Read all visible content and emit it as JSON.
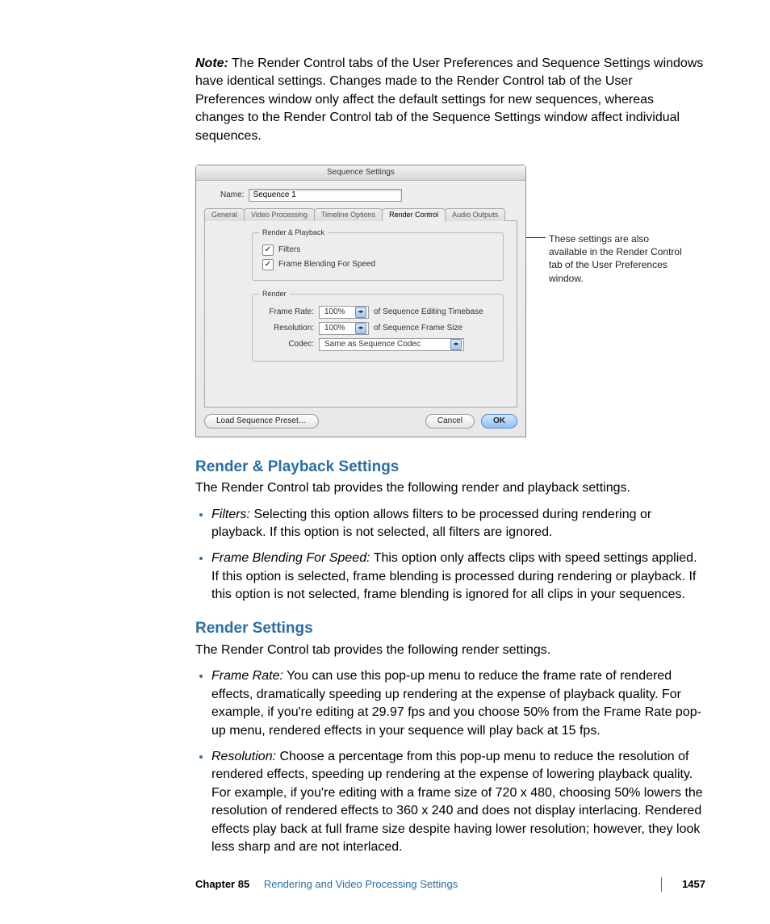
{
  "note": {
    "label": "Note:",
    "text": "The Render Control tabs of the User Preferences and Sequence Settings windows have identical settings. Changes made to the Render Control tab of the User Preferences window only affect the default settings for new sequences, whereas changes to the Render Control tab of the Sequence Settings window affect individual sequences."
  },
  "window": {
    "title": "Sequence Settings",
    "name_label": "Name:",
    "name_value": "Sequence 1",
    "tabs": [
      "General",
      "Video Processing",
      "Timeline Options",
      "Render Control",
      "Audio Outputs"
    ],
    "group_playback": {
      "title": "Render & Playback",
      "filters_label": "Filters",
      "frameblend_label": "Frame Blending For Speed"
    },
    "group_render": {
      "title": "Render",
      "frame_rate_label": "Frame Rate:",
      "frame_rate_value": "100%",
      "frame_rate_suffix": "of Sequence Editing Timebase",
      "resolution_label": "Resolution:",
      "resolution_value": "100%",
      "resolution_suffix": "of Sequence Frame Size",
      "codec_label": "Codec:",
      "codec_value": "Same as Sequence Codec"
    },
    "buttons": {
      "load": "Load Sequence Preset…",
      "cancel": "Cancel",
      "ok": "OK"
    }
  },
  "callout": "These settings are also available in the Render Control tab of the User Preferences window.",
  "section1": {
    "heading": "Render & Playback Settings",
    "intro": "The Render Control tab provides the following render and playback settings.",
    "items": [
      {
        "term": "Filters:",
        "text": "Selecting this option allows filters to be processed during rendering or playback. If this option is not selected, all filters are ignored."
      },
      {
        "term": "Frame Blending For Speed:",
        "text": "This option only affects clips with speed settings applied. If this option is selected, frame blending is processed during rendering or playback. If this option is not selected, frame blending is ignored for all clips in your sequences."
      }
    ]
  },
  "section2": {
    "heading": "Render Settings",
    "intro": "The Render Control tab provides the following render settings.",
    "items": [
      {
        "term": "Frame Rate:",
        "text": "You can use this pop-up menu to reduce the frame rate of rendered effects, dramatically speeding up rendering at the expense of playback quality. For example, if you're editing at 29.97 fps and you choose 50% from the Frame Rate pop-up menu, rendered effects in your sequence will play back at 15 fps."
      },
      {
        "term": "Resolution:",
        "text": "Choose a percentage from this pop-up menu to reduce the resolution of rendered effects, speeding up rendering at the expense of lowering playback quality. For example, if you're editing with a frame size of 720 x 480, choosing 50% lowers the resolution of rendered effects to 360 x 240 and does not display interlacing. Rendered effects play back at full frame size despite having lower resolution; however, they look less sharp and are not interlaced."
      }
    ]
  },
  "footer": {
    "chapter": "Chapter 85",
    "title": "Rendering and Video Processing Settings",
    "page": "1457"
  }
}
